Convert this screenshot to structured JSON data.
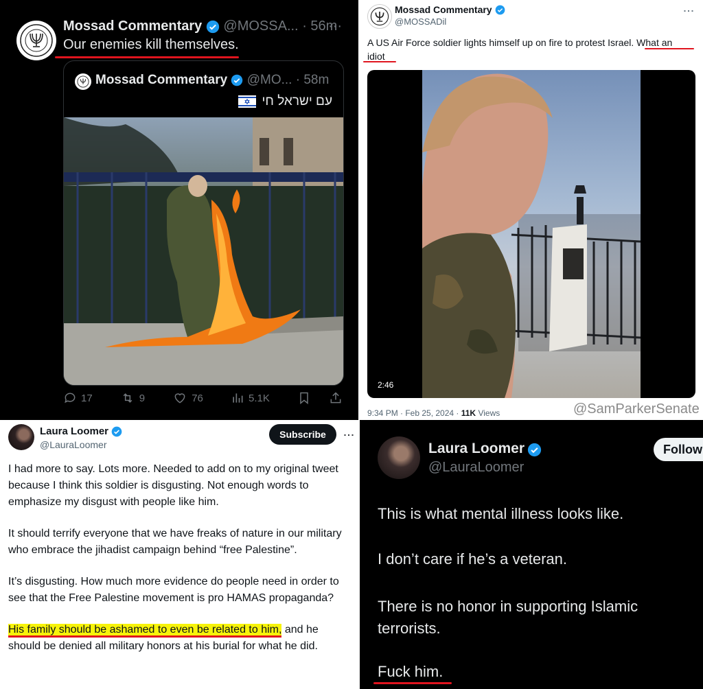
{
  "tl": {
    "name": "Mossad Commentary",
    "handle": "@MOSSA...",
    "time": "· 56m",
    "more": "···",
    "text": "Our enemies kill themselves.",
    "quote": {
      "name": "Mossad Commentary",
      "handle": "@MO...",
      "time": "· 58m",
      "hebrew": "עם ישראל חי"
    },
    "stats": {
      "replies": "17",
      "reposts": "9",
      "likes": "76",
      "views": "5.1K"
    }
  },
  "tr": {
    "name": "Mossad Commentary",
    "handle": "@MOSSADil",
    "more": "⋮",
    "text_a": "A US Air Force soldier lights himself up on fire to protest Israel",
    "text_b": ". What an",
    "text_c": "idiot",
    "duration": "2:46",
    "meta_time": "9:34 PM · Feb 25, 2024 · ",
    "meta_views": "11K",
    "meta_views_label": " Views",
    "watermark": "@SamParkerSenate"
  },
  "bl": {
    "name": "Laura Loomer",
    "handle": "@LauraLoomer",
    "subscribe": "Subscribe",
    "more": "⋮",
    "p1": "I had more to say. Lots more. Needed to add on to my original tweet because I think this soldier is disgusting. Not enough words to emphasize my disgust with people like him.",
    "p2": "It should terrify everyone that we have freaks of nature in our military who embrace the jihadist campaign behind “free Palestine”.",
    "p3": "It’s disgusting. How much more evidence do people need in order to see that the Free Palestine movement is pro HAMAS propaganda?",
    "p4_hl": "His family should be ashamed to even be related to him,",
    "p4_rest": " and he should be denied all military honors at his burial for what he did."
  },
  "br": {
    "name": "Laura Loomer",
    "handle": "@LauraLoomer",
    "follow": "Follow",
    "l1": "This is what mental illness looks like.",
    "l2": "I don’t care if he’s a veteran.",
    "l3": "There is no honor in supporting Islamic terrorists.",
    "l4": "Fuck him."
  },
  "colors": {
    "verified": "#1d9bf0",
    "underline": "#e0141e",
    "highlight": "#f7f30a"
  }
}
